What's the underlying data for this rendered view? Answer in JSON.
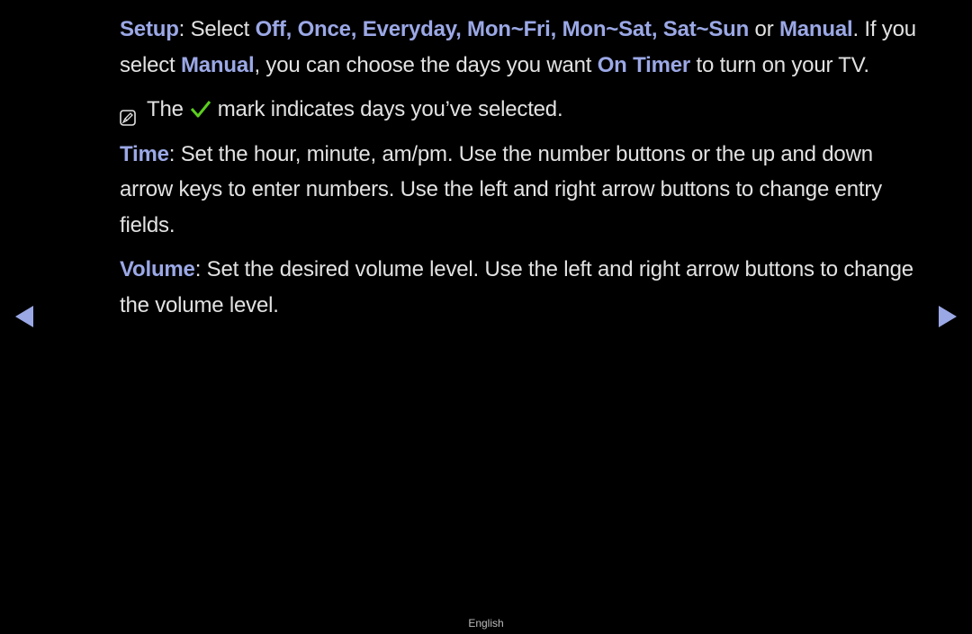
{
  "setup": {
    "label": "Setup",
    "sep": ": Select ",
    "options": "Off, Once, Everyday, Mon~Fri, Mon~Sat, Sat~Sun",
    "or": " or ",
    "manual": "Manual",
    "period": ".",
    "line2_a": " If you select ",
    "manual2": "Manual",
    "line2_b": ", you can choose the days you want ",
    "on_timer": "On Timer",
    "line2_c": " to turn on your TV."
  },
  "note": {
    "icon": "note-icon",
    "before": "The",
    "check_icon": "green-checkmark-icon",
    "after": "mark indicates days you’ve selected."
  },
  "time": {
    "label": "Time",
    "text": ": Set the hour, minute, am/pm. Use the number buttons or the up and down arrow keys to enter numbers. Use the left and right arrow buttons to change entry fields."
  },
  "volume": {
    "label": "Volume",
    "text": ": Set the desired volume level. Use the left and right arrow buttons to change the volume level."
  },
  "nav": {
    "prev_icon": "left-arrow-icon",
    "next_icon": "right-arrow-icon"
  },
  "colors": {
    "highlight": "#9ba8e6",
    "text": "#e2e2e2",
    "check": "#5ccf1f",
    "background": "#000000"
  },
  "footer": {
    "language": "English"
  }
}
